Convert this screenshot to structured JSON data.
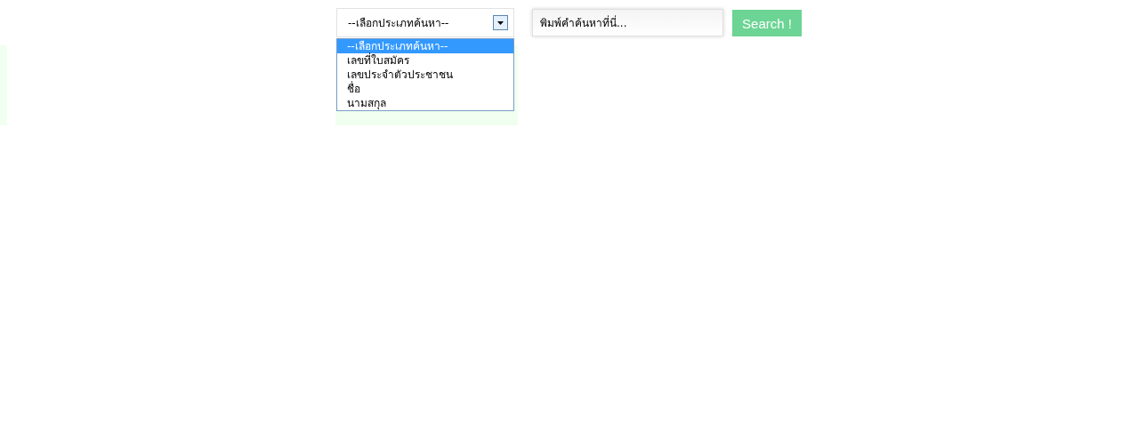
{
  "search_type": {
    "value": "--เลือกประเภทค้นหา--",
    "expanded": true,
    "options": [
      {
        "label": "--เลือกประเภทค้นหา--",
        "selected": true
      },
      {
        "label": "เลขที่ใบสมัคร",
        "selected": false
      },
      {
        "label": "เลขประจำตัวประชาชน",
        "selected": false
      },
      {
        "label": "ชื่อ",
        "selected": false
      },
      {
        "label": "นามสกุล",
        "selected": false
      }
    ]
  },
  "search": {
    "placeholder": "พิมพ์คำค้นหาที่นี่..."
  },
  "search_button": {
    "label": "Search !"
  }
}
